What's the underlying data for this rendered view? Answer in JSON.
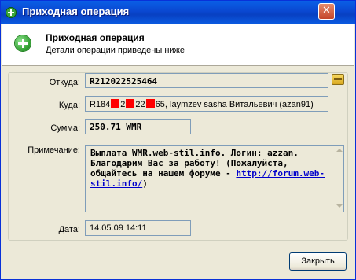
{
  "window": {
    "title": "Приходная операция",
    "close_glyph": "✕"
  },
  "header": {
    "title": "Приходная операция",
    "subtitle": "Детали операции приведены ниже"
  },
  "fields": {
    "from_label": "Откуда:",
    "from_value": "R212022525464",
    "to_label": "Куда:",
    "to_prefix": "R184",
    "to_mid1": "2",
    "to_mid2": "22",
    "to_suffix": "65, laymzev sasha Витальевич (azan91)",
    "amount_label": "Сумма:",
    "amount_value": "250.71 WMR",
    "note_label": "Примечание:",
    "note_line1": "Выплата WMR.web-stil.info. Логин: azzan.",
    "note_line2": "Благодарим Вас за работу! (Пожалуйста,",
    "note_line3_text": "общайтесь на нашем форуме - ",
    "note_line3_link": "http://forum.web-",
    "note_line4_link": "stil.info/",
    "note_line4_tail": ")",
    "date_label": "Дата:",
    "date_value": "14.05.09 14:11"
  },
  "buttons": {
    "close_label": "Закрыть"
  },
  "colors": {
    "titlebar": "#0a48d1",
    "redaction": "#ff0000",
    "link": "#0000cc",
    "success_icon": "#2c9b2c"
  },
  "icons": {
    "title": "plus-icon",
    "header": "plus-circle-icon",
    "wallet": "wallet-icon"
  }
}
